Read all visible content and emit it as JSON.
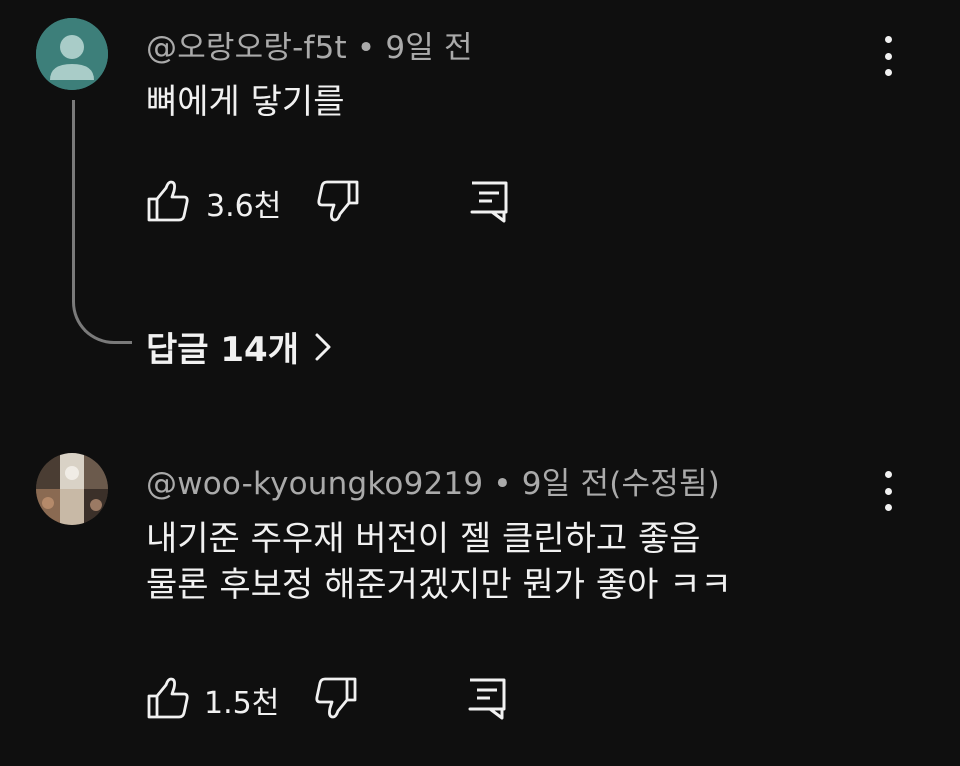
{
  "comments": [
    {
      "author": "@오랑오랑-f5t",
      "separator": "•",
      "time": "9일 전",
      "text_lines": [
        "뼈에게 닿기를"
      ],
      "like_count": "3.6천",
      "avatar": "default-user-avatar",
      "avatar_color": "#3d7f7a",
      "replies_label": "답글 14개"
    },
    {
      "author": "@woo-kyoungko9219",
      "separator": "•",
      "time": "9일 전(수정됨)",
      "text_lines": [
        "내기준 주우재 버전이 젤 클린하고 좋음",
        "물론 후보정 해준거겠지만 뭔가 좋아 ㅋㅋ"
      ],
      "like_count": "1.5천",
      "avatar": "photo-collage-avatar"
    }
  ],
  "icons": {
    "like": "thumbs-up-icon",
    "dislike": "thumbs-down-icon",
    "reply": "reply-icon",
    "more": "kebab-menu-icon",
    "expand": "chevron-right-icon"
  }
}
